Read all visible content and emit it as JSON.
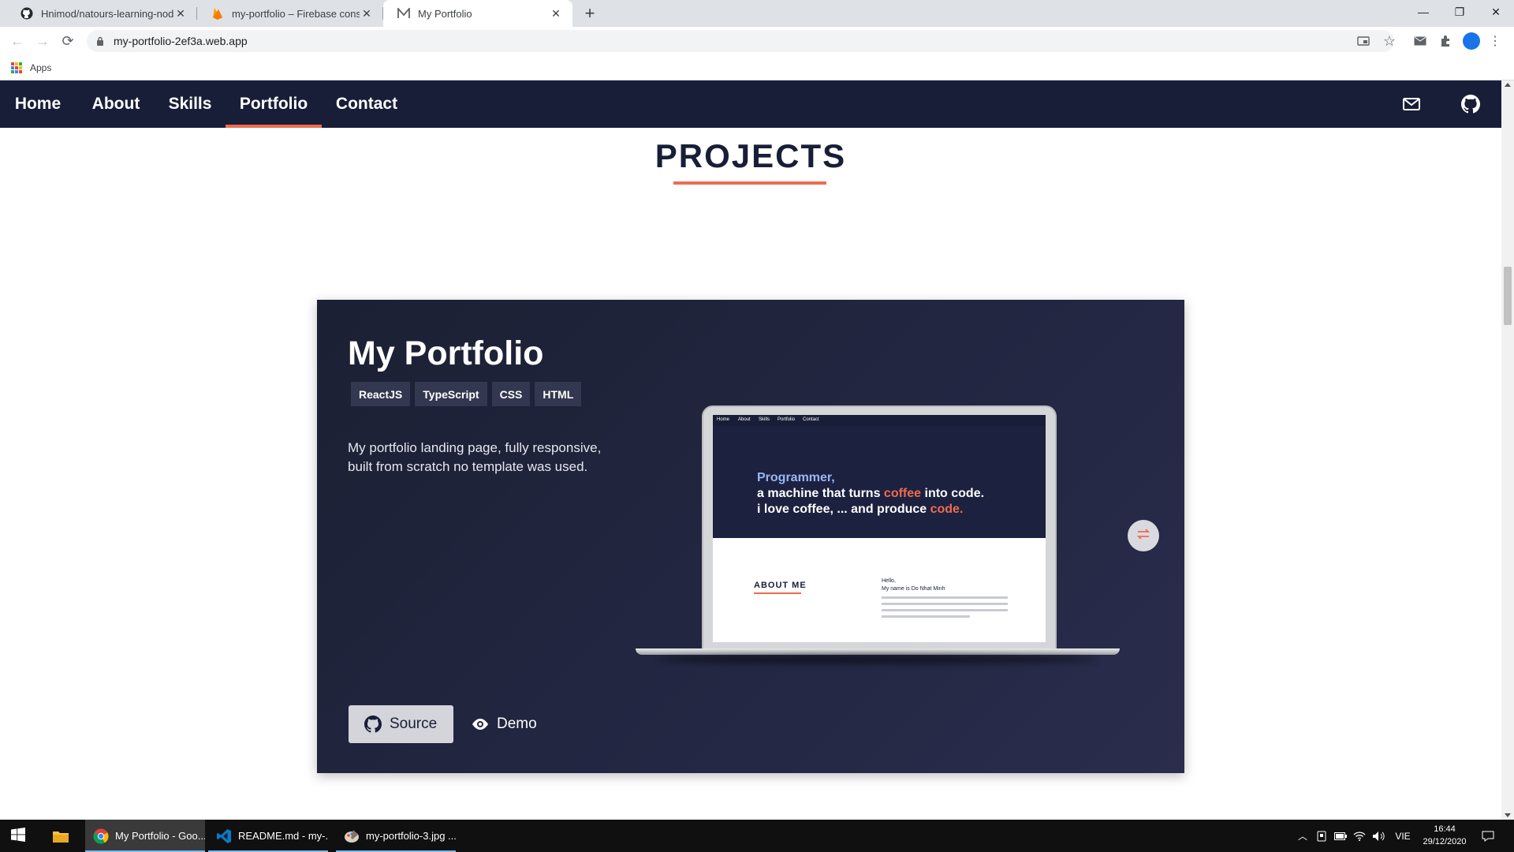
{
  "browser": {
    "tabs": [
      {
        "title": "Hnimod/natours-learning-nodejs",
        "icon": "github-icon"
      },
      {
        "title": "my-portfolio – Firebase console",
        "icon": "firebase-icon"
      },
      {
        "title": "My Portfolio",
        "icon": "portfolio-logo-icon",
        "active": true
      }
    ],
    "address": "my-portfolio-2ef3a.web.app",
    "bookmarks": {
      "apps_label": "Apps"
    }
  },
  "site": {
    "nav": {
      "links": [
        "Home",
        "About",
        "Skills",
        "Portfolio",
        "Contact"
      ],
      "active": "Portfolio"
    },
    "section_title": "PROJECTS",
    "project": {
      "title": "My Portfolio",
      "tags": [
        "ReactJS",
        "TypeScript",
        "CSS",
        "HTML"
      ],
      "description": "My portfolio landing page, fully responsive, built from scratch no template was used.",
      "source_label": "Source",
      "demo_label": "Demo",
      "preview": {
        "nav": [
          "Home",
          "About",
          "Skills",
          "Portfolio",
          "Contact"
        ],
        "hero_line1": "Programmer,",
        "hero_line2_a": "a machine that turns ",
        "hero_line2_accent": "coffee",
        "hero_line2_b": " into code.",
        "hero_line3_a": "i love coffee, ... and produce ",
        "hero_line3_accent": "code",
        "hero_line3_b": ".",
        "about_heading": "ABOUT ME",
        "hello": "Hello,",
        "name_line": "My name is Do Nhat Minh"
      }
    },
    "colors": {
      "navy": "#191e38",
      "accent": "#ee6c4d"
    }
  },
  "taskbar": {
    "items": [
      {
        "label": "My Portfolio - Goo...",
        "icon": "chrome-icon"
      },
      {
        "label": "README.md - my-...",
        "icon": "vscode-icon"
      },
      {
        "label": "my-portfolio-3.jpg ...",
        "icon": "paint-icon"
      }
    ],
    "language": "VIE",
    "time": "16:44",
    "date": "29/12/2020"
  }
}
